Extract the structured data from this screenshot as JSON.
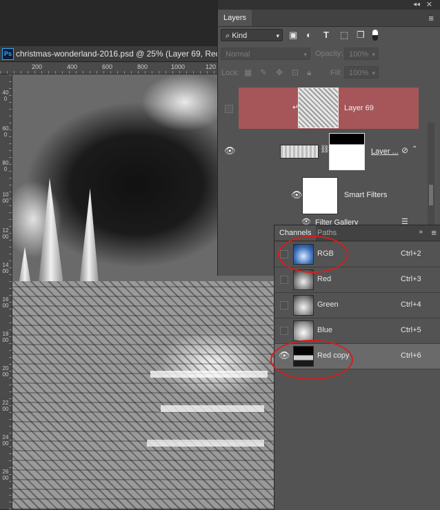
{
  "document": {
    "app_badge": "Ps",
    "tab_title": "christmas-wonderland-2016.psd @ 25% (Layer 69, Red c",
    "ruler_top_ticks": [
      "200",
      "400",
      "600",
      "800",
      "1000",
      "120"
    ],
    "ruler_left_ticks": [
      "400",
      "600",
      "800",
      "1000",
      "1200",
      "1400",
      "1600",
      "1800",
      "2000",
      "2200",
      "2400",
      "2600"
    ]
  },
  "layers_panel": {
    "collapse_glyph": "◂◂",
    "close_glyph": "✕",
    "tab_label": "Layers",
    "menu_glyph": "≡",
    "filter_type": "Kind",
    "filter_icons": [
      "image-filter-icon",
      "adjustment-filter-icon",
      "type-filter-icon",
      "shape-filter-icon",
      "smart-object-filter-icon",
      "filter-toggle-icon"
    ],
    "blend_mode": "Normal",
    "opacity_label": "Opacity:",
    "opacity_value": "100%",
    "lock_label": "Lock:",
    "fill_label": "Fill:",
    "fill_value": "100%",
    "layers": [
      {
        "name": "Layer 69",
        "visible": false,
        "selected": true,
        "clipped": true
      },
      {
        "name": "Layer ...",
        "visible": true,
        "selected": false,
        "has_mask": true,
        "smart_object": true
      },
      {
        "name": "Smart Filters",
        "visible": true
      },
      {
        "name": "Filter Gallery",
        "visible": true
      }
    ]
  },
  "channels_panel": {
    "tabs": [
      "Channels",
      "Paths"
    ],
    "active_tab": "Channels",
    "expand_glyph": "»",
    "menu_glyph": "≡",
    "channels": [
      {
        "name": "RGB",
        "shortcut": "Ctrl+2",
        "visible": false,
        "selected": false,
        "circled": true
      },
      {
        "name": "Red",
        "shortcut": "Ctrl+3",
        "visible": false,
        "selected": false,
        "circled": false
      },
      {
        "name": "Green",
        "shortcut": "Ctrl+4",
        "visible": false,
        "selected": false,
        "circled": false
      },
      {
        "name": "Blue",
        "shortcut": "Ctrl+5",
        "visible": false,
        "selected": false,
        "circled": false
      },
      {
        "name": "Red copy",
        "shortcut": "Ctrl+6",
        "visible": true,
        "selected": true,
        "circled": true
      }
    ]
  },
  "colors": {
    "selected_layer": "#a65558",
    "annotation_ring": "#d61e1e",
    "panel_bg": "#535353",
    "app_bg": "#282828"
  }
}
